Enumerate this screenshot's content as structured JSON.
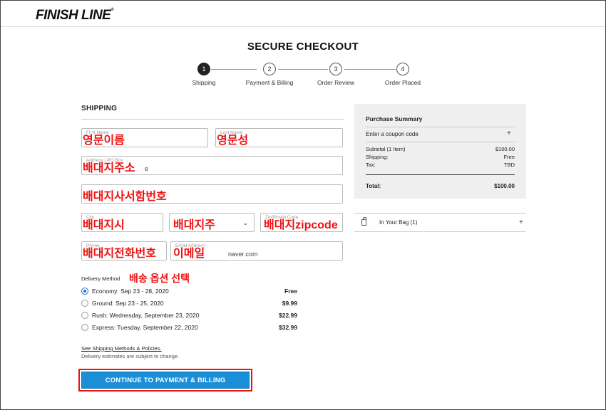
{
  "header": {
    "logo": "FINISH LINE",
    "logo_mark": "®"
  },
  "page_title": "SECURE CHECKOUT",
  "steps": [
    {
      "num": "1",
      "label": "Shipping",
      "active": true
    },
    {
      "num": "2",
      "label": "Payment & Billing",
      "active": false
    },
    {
      "num": "3",
      "label": "Order Review",
      "active": false
    },
    {
      "num": "4",
      "label": "Order Placed",
      "active": false
    }
  ],
  "shipping": {
    "title": "SHIPPING",
    "fields": {
      "first_name": {
        "placeholder": "First Name",
        "value": ""
      },
      "last_name": {
        "placeholder": "Last Name",
        "value": ""
      },
      "address": {
        "placeholder": "Address / PO Box",
        "value": "e"
      },
      "address2": {
        "placeholder": "",
        "value": ""
      },
      "city": {
        "placeholder": "City",
        "value": ""
      },
      "state": {
        "placeholder": "",
        "value": ""
      },
      "zip": {
        "placeholder": "Zip/Postal Code",
        "value": ""
      },
      "phone": {
        "placeholder": "Phone",
        "value": ""
      },
      "email": {
        "placeholder": "Email Address",
        "value": "naver.com"
      }
    }
  },
  "annotations": {
    "first_name": "영문이름",
    "last_name": "영문성",
    "address": "배대지주소",
    "address2": "배대지사서함번호",
    "city": "배대지시",
    "state": "배대지주",
    "zip": "배대지zipcode",
    "phone": "배대지전화번호",
    "email": "이메일",
    "delivery": "배송 옵션 선택"
  },
  "delivery": {
    "label": "Delivery Method",
    "options": [
      {
        "label": "Economy: Sep 23 - 28, 2020",
        "price": "Free",
        "selected": true
      },
      {
        "label": "Ground: Sep 23 - 25, 2020",
        "price": "$9.99",
        "selected": false
      },
      {
        "label": "Rush: Wednesday, September 23, 2020",
        "price": "$22.99",
        "selected": false
      },
      {
        "label": "Express: Tuesday, September 22, 2020",
        "price": "$32.99",
        "selected": false
      }
    ],
    "policy_link": "See Shipping Methods & Policies.",
    "policy_note": "Delivery estimates are subject to change."
  },
  "cta": {
    "label": "CONTINUE TO PAYMENT & BILLING"
  },
  "summary": {
    "title": "Purchase Summary",
    "coupon": "Enter a coupon code",
    "rows": [
      {
        "label": "Subtotal (1 Item)",
        "value": "$100.00"
      },
      {
        "label": "Shipping:",
        "value": "Free"
      },
      {
        "label": "Tax:",
        "value": "TBD"
      }
    ],
    "total": {
      "label": "Total:",
      "value": "$100.00"
    }
  },
  "bag": {
    "label": "In Your Bag (1)"
  },
  "icons": {
    "plus": "+",
    "chevron": "⌄"
  },
  "colors": {
    "accent": "#1a8fd8",
    "annotation": "#ee1111"
  }
}
